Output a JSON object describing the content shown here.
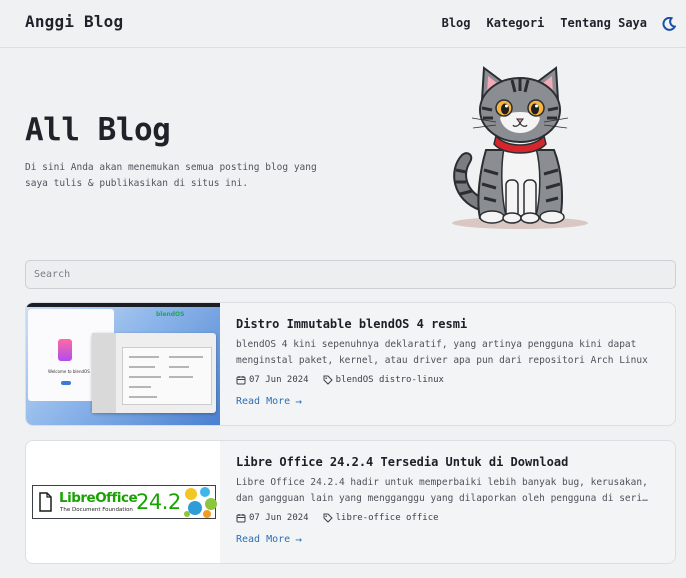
{
  "header": {
    "brand": "Anggi Blog",
    "nav": [
      {
        "label": "Blog"
      },
      {
        "label": "Kategori"
      },
      {
        "label": "Tentang Saya"
      }
    ],
    "theme_icon": "moon-icon"
  },
  "hero": {
    "title": "All Blog",
    "description": "Di sini Anda akan menemukan semua posting blog yang saya tulis & publikasikan di situs ini.",
    "illustration": "cat-illustration"
  },
  "search": {
    "placeholder": "Search"
  },
  "posts": [
    {
      "title": "Distro Immutable blendOS 4 resmi",
      "excerpt": "blendOS 4 kini sepenuhnya deklaratif, yang artinya pengguna kini dapat menginstal paket, kernel, atau driver apa pun dari repositori Arch Linux dan AUR…",
      "date": "07 Jun 2024",
      "tags": "blendOS distro-linux",
      "read_more": "Read More",
      "thumb": {
        "welcome": "Welcome to blendOS",
        "brand": "blendOS"
      }
    },
    {
      "title": "Libre Office 24.2.4 Tersedia Untuk di Download",
      "excerpt": "Libre Office 24.2.4 hadir untuk memperbaiki lebih banyak bug, kerusakan, dan gangguan lain yang mengganggu yang dilaporkan oleh pengguna di seri…",
      "date": "07 Jun 2024",
      "tags": "libre-office office",
      "read_more": "Read More",
      "thumb": {
        "name": "LibreOffice",
        "sub": "The Document Foundation",
        "version": "24.2"
      }
    }
  ],
  "colors": {
    "background": "#f0f1f3",
    "link": "#2d6fb1",
    "libreoffice_green": "#18a303"
  }
}
